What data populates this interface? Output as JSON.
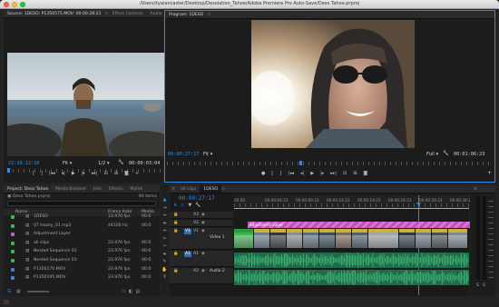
{
  "window": {
    "title": "/Users/kyalancaster/Desktop/Desolation_Tahoe/Adobe Premiere Pro Auto-Save/Deso Tahoe.prproj"
  },
  "source_monitor": {
    "tabs": [
      "Source: 1DESO: P1350575.MOV: 00:00:28:21",
      "Effect Controls",
      "Audio Cl"
    ],
    "timecode_left": "22:38:12:10",
    "fit": "Fit",
    "resolution": "1/2",
    "timecode_right": "00:00:03:04"
  },
  "program_monitor": {
    "tab": "Program: 1DESO",
    "timecode_left": "00:00:27:17",
    "fit": "Fit",
    "resolution": "Full",
    "timecode_right": "00:01:06:23"
  },
  "project": {
    "tabs": [
      "Project: Deso Tahoe",
      "Media Browser",
      "Info",
      "Effects",
      "Marke"
    ],
    "file": "Deso Tahoe.prproj",
    "item_count": "84 Items",
    "columns": [
      "Name",
      "Frame Rate",
      "Media"
    ],
    "items": [
      {
        "name": "1DESO",
        "rate": "23.976 fps",
        "media": "00:0",
        "color": "#3fb34f"
      },
      {
        "name": "07 Hazey_01.mp3",
        "rate": "44100 Hz",
        "media": "00:0",
        "color": "#3fb34f"
      },
      {
        "name": "Adjustment Layer",
        "rate": "",
        "media": "",
        "color": "#b56ac1"
      },
      {
        "name": "all clips",
        "rate": "23.976 fps",
        "media": "00:0",
        "color": "#3fb34f"
      },
      {
        "name": "Nested Sequence 02",
        "rate": "23.976 fps",
        "media": "00:0",
        "color": "#3fb34f"
      },
      {
        "name": "Nested Sequence 03",
        "rate": "23.976 fps",
        "media": "00:0",
        "color": "#3fb34f"
      },
      {
        "name": "P1350170.MOV",
        "rate": "23.976 fps",
        "media": "00:0",
        "color": "#4a7dd6"
      },
      {
        "name": "P1350195.MOV",
        "rate": "23.976 fps",
        "media": "00:0",
        "color": "#4a7dd6"
      }
    ]
  },
  "timeline": {
    "tabs": [
      "all clips",
      "1DESO"
    ],
    "timecode": "00:00:27:17",
    "ruler_labels": [
      "00:00",
      "00:00:04:23",
      "00:00:09:23",
      "00:00:14:23",
      "00:00:19:23",
      "00:00:24:23",
      "00:00:29:23",
      "00:00:34:23"
    ],
    "tracks": [
      {
        "id": "V3",
        "name": ""
      },
      {
        "id": "V2",
        "name": ""
      },
      {
        "id": "V1",
        "name": "Video 1"
      },
      {
        "id": "A1",
        "name": ""
      },
      {
        "id": "A2",
        "name": "Audio 2"
      }
    ],
    "adjustment_clip": "Adjustment Layer",
    "clip_labels": [
      "Nest",
      "P135",
      "P1350",
      "P135",
      "P135",
      "P135",
      "P135",
      "P135",
      "P1350577.MOV",
      "P135",
      "P135",
      "P135",
      "P135"
    ]
  },
  "meters": {
    "labels": [
      "S",
      "S"
    ]
  }
}
